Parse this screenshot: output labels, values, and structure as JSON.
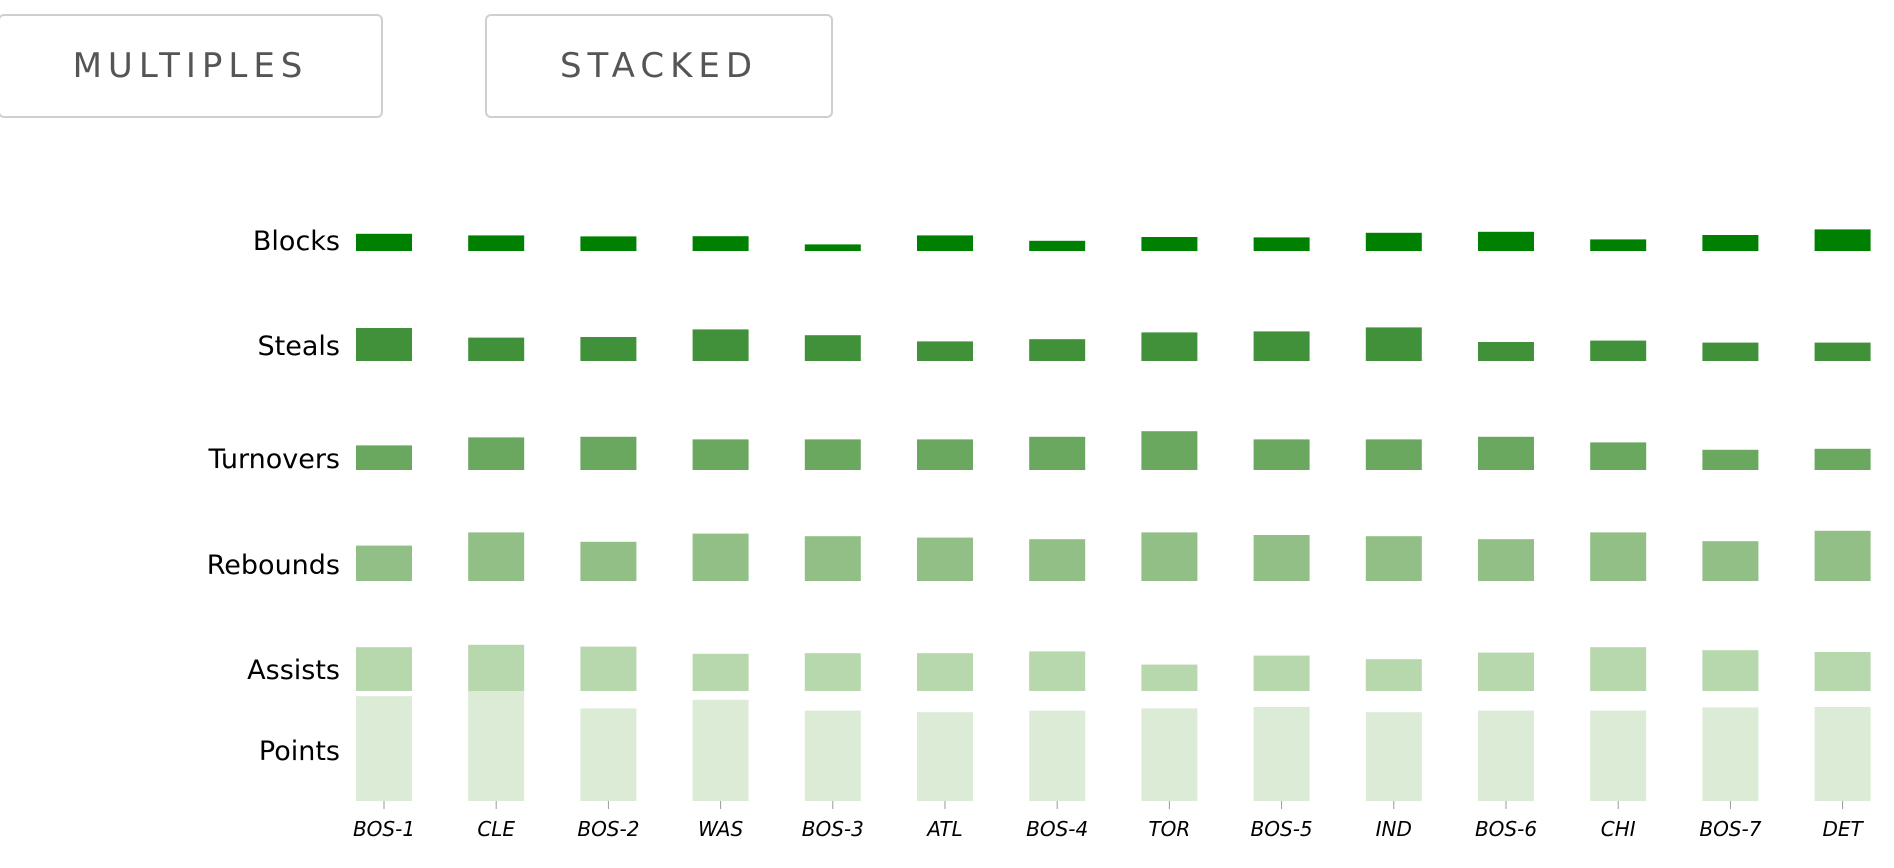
{
  "controls": {
    "multiples_label": "MULTIPLES",
    "stacked_label": "STACKED"
  },
  "chart_data": {
    "type": "bar",
    "layout": "small-multiples",
    "categories": [
      "BOS-1",
      "CLE",
      "BOS-2",
      "WAS",
      "BOS-3",
      "ATL",
      "BOS-4",
      "TOR",
      "BOS-5",
      "IND",
      "BOS-6",
      "CHI",
      "BOS-7",
      "DET"
    ],
    "series": [
      {
        "name": "Blocks",
        "color": "#008000",
        "values": [
          8.6,
          7.8,
          7.3,
          7.4,
          3.3,
          7.8,
          5.1,
          7.0,
          6.8,
          9.1,
          9.6,
          5.8,
          8.0,
          10.8
        ]
      },
      {
        "name": "Steals",
        "color": "#41913a",
        "values": [
          16.5,
          11.7,
          12.0,
          15.8,
          12.9,
          9.8,
          10.9,
          14.3,
          14.8,
          16.8,
          9.5,
          10.2,
          9.2,
          9.2
        ]
      },
      {
        "name": "Turnovers",
        "color": "#6aa75f",
        "values": [
          12.3,
          16.3,
          16.6,
          15.3,
          15.3,
          15.3,
          16.6,
          19.4,
          15.3,
          15.3,
          16.6,
          13.8,
          10.1,
          10.6
        ]
      },
      {
        "name": "Rebounds",
        "color": "#91bf86",
        "values": [
          17.7,
          24.3,
          19.6,
          23.7,
          22.4,
          21.7,
          20.9,
          24.3,
          23.0,
          22.4,
          20.9,
          24.3,
          19.9,
          25.1
        ]
      },
      {
        "name": "Assists",
        "color": "#b7d7ad",
        "values": [
          21.9,
          23.1,
          22.2,
          18.6,
          18.9,
          18.9,
          19.8,
          13.2,
          17.7,
          15.9,
          19.2,
          21.9,
          20.4,
          19.5
        ]
      },
      {
        "name": "Points",
        "color": "#dbebd5",
        "values": [
          52.4,
          55.0,
          46.3,
          50.6,
          45.2,
          44.4,
          45.2,
          46.3,
          47.0,
          44.4,
          45.2,
          45.2,
          46.8,
          47.0
        ]
      }
    ]
  }
}
